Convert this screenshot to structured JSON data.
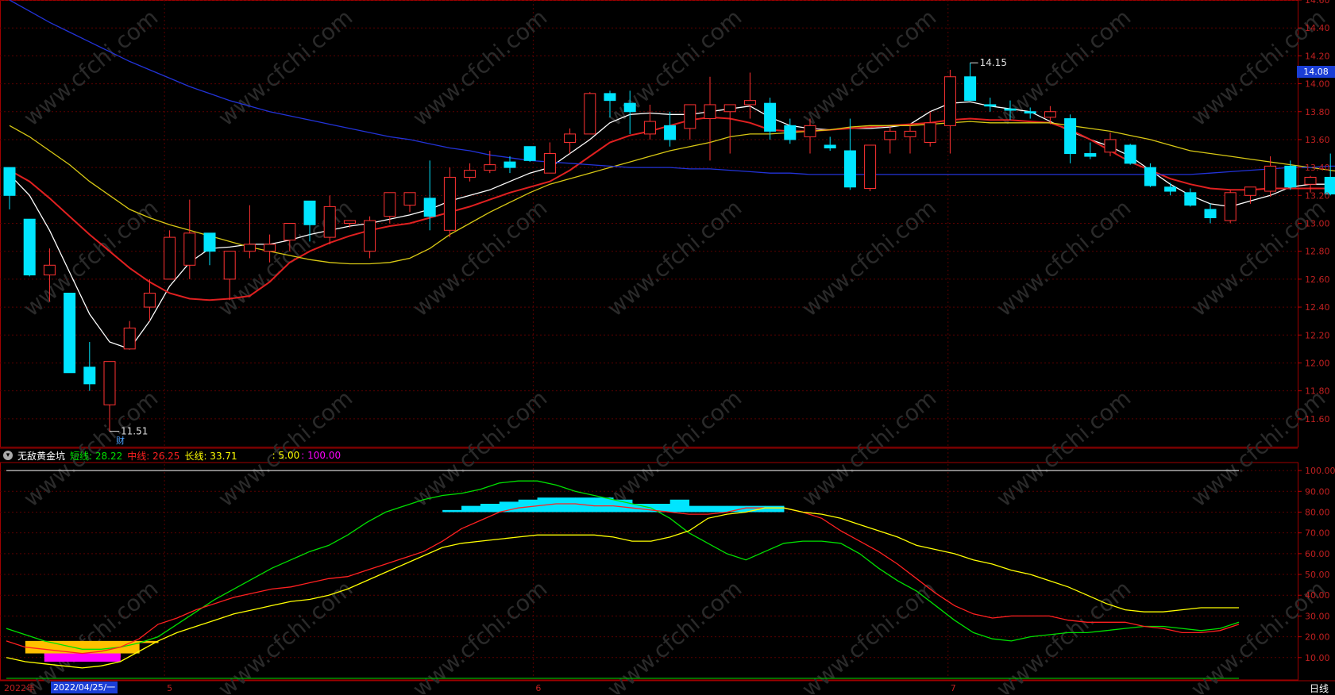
{
  "chart_data": [
    {
      "type": "candlestick",
      "ylim": [
        11.4,
        14.6
      ],
      "y_ticks": [
        "14.60",
        "14.40",
        "14.20",
        "14.00",
        "13.80",
        "13.60",
        "13.40",
        "13.20",
        "13.00",
        "12.80",
        "12.60",
        "12.40",
        "12.20",
        "12.00",
        "11.80",
        "11.60"
      ],
      "current_price": "14.08",
      "annotations": {
        "high_label": "14.15",
        "low_label": "11.51",
        "event_marker": "财"
      },
      "candles": [
        {
          "o": 13.4,
          "h": 13.4,
          "l": 13.1,
          "c": 13.2
        },
        {
          "o": 13.03,
          "h": 13.03,
          "l": 12.62,
          "c": 12.63
        },
        {
          "o": 12.63,
          "h": 12.82,
          "l": 12.44,
          "c": 12.7
        },
        {
          "o": 12.5,
          "h": 12.5,
          "l": 11.93,
          "c": 11.93
        },
        {
          "o": 11.97,
          "h": 12.15,
          "l": 11.8,
          "c": 11.85
        },
        {
          "o": 11.7,
          "h": 12.01,
          "l": 11.51,
          "c": 12.01
        },
        {
          "o": 12.1,
          "h": 12.3,
          "l": 12.1,
          "c": 12.25
        },
        {
          "o": 12.4,
          "h": 12.6,
          "l": 12.3,
          "c": 12.5
        },
        {
          "o": 12.6,
          "h": 12.95,
          "l": 12.6,
          "c": 12.9
        },
        {
          "o": 12.7,
          "h": 13.17,
          "l": 12.6,
          "c": 12.93
        },
        {
          "o": 12.93,
          "h": 12.93,
          "l": 12.7,
          "c": 12.8
        },
        {
          "o": 12.6,
          "h": 12.8,
          "l": 12.45,
          "c": 12.8
        },
        {
          "o": 12.8,
          "h": 13.13,
          "l": 12.75,
          "c": 12.85
        },
        {
          "o": 12.8,
          "h": 12.92,
          "l": 12.72,
          "c": 12.85
        },
        {
          "o": 12.88,
          "h": 13.0,
          "l": 12.8,
          "c": 13.0
        },
        {
          "o": 13.16,
          "h": 13.16,
          "l": 12.87,
          "c": 12.99
        },
        {
          "o": 12.9,
          "h": 13.2,
          "l": 12.85,
          "c": 13.12
        },
        {
          "o": 13.0,
          "h": 13.02,
          "l": 12.97,
          "c": 13.02
        },
        {
          "o": 12.8,
          "h": 13.05,
          "l": 12.75,
          "c": 13.02
        },
        {
          "o": 13.05,
          "h": 13.22,
          "l": 13.0,
          "c": 13.22
        },
        {
          "o": 13.13,
          "h": 13.22,
          "l": 13.08,
          "c": 13.22
        },
        {
          "o": 13.18,
          "h": 13.45,
          "l": 12.95,
          "c": 13.05
        },
        {
          "o": 12.95,
          "h": 13.4,
          "l": 12.9,
          "c": 13.33
        },
        {
          "o": 13.33,
          "h": 13.43,
          "l": 13.3,
          "c": 13.38
        },
        {
          "o": 13.38,
          "h": 13.52,
          "l": 13.36,
          "c": 13.42
        },
        {
          "o": 13.44,
          "h": 13.48,
          "l": 13.36,
          "c": 13.4
        },
        {
          "o": 13.55,
          "h": 13.55,
          "l": 13.44,
          "c": 13.45
        },
        {
          "o": 13.36,
          "h": 13.58,
          "l": 13.36,
          "c": 13.5
        },
        {
          "o": 13.58,
          "h": 13.68,
          "l": 13.5,
          "c": 13.64
        },
        {
          "o": 13.64,
          "h": 13.94,
          "l": 13.64,
          "c": 13.93
        },
        {
          "o": 13.93,
          "h": 13.95,
          "l": 13.76,
          "c": 13.88
        },
        {
          "o": 13.86,
          "h": 13.95,
          "l": 13.64,
          "c": 13.8
        },
        {
          "o": 13.64,
          "h": 13.85,
          "l": 13.6,
          "c": 13.73
        },
        {
          "o": 13.7,
          "h": 13.8,
          "l": 13.55,
          "c": 13.6
        },
        {
          "o": 13.68,
          "h": 13.85,
          "l": 13.6,
          "c": 13.85
        },
        {
          "o": 13.75,
          "h": 14.05,
          "l": 13.45,
          "c": 13.85
        },
        {
          "o": 13.8,
          "h": 13.85,
          "l": 13.5,
          "c": 13.85
        },
        {
          "o": 13.85,
          "h": 14.08,
          "l": 13.75,
          "c": 13.88
        },
        {
          "o": 13.86,
          "h": 13.9,
          "l": 13.6,
          "c": 13.66
        },
        {
          "o": 13.7,
          "h": 13.75,
          "l": 13.57,
          "c": 13.6
        },
        {
          "o": 13.62,
          "h": 13.75,
          "l": 13.5,
          "c": 13.7
        },
        {
          "o": 13.56,
          "h": 13.62,
          "l": 13.52,
          "c": 13.54
        },
        {
          "o": 13.52,
          "h": 13.75,
          "l": 13.24,
          "c": 13.26
        },
        {
          "o": 13.25,
          "h": 13.56,
          "l": 13.23,
          "c": 13.56
        },
        {
          "o": 13.6,
          "h": 13.69,
          "l": 13.5,
          "c": 13.66
        },
        {
          "o": 13.62,
          "h": 13.7,
          "l": 13.5,
          "c": 13.66
        },
        {
          "o": 13.58,
          "h": 13.8,
          "l": 13.55,
          "c": 13.72
        },
        {
          "o": 13.7,
          "h": 14.1,
          "l": 13.5,
          "c": 14.05
        },
        {
          "o": 14.05,
          "h": 14.15,
          "l": 13.88,
          "c": 13.88
        },
        {
          "o": 13.85,
          "h": 13.9,
          "l": 13.8,
          "c": 13.84
        },
        {
          "o": 13.82,
          "h": 13.88,
          "l": 13.74,
          "c": 13.81
        },
        {
          "o": 13.8,
          "h": 13.83,
          "l": 13.75,
          "c": 13.79
        },
        {
          "o": 13.76,
          "h": 13.84,
          "l": 13.71,
          "c": 13.8
        },
        {
          "o": 13.75,
          "h": 13.78,
          "l": 13.43,
          "c": 13.5
        },
        {
          "o": 13.5,
          "h": 13.58,
          "l": 13.46,
          "c": 13.48
        },
        {
          "o": 13.51,
          "h": 13.65,
          "l": 13.48,
          "c": 13.6
        },
        {
          "o": 13.56,
          "h": 13.57,
          "l": 13.42,
          "c": 13.43
        },
        {
          "o": 13.4,
          "h": 13.43,
          "l": 13.26,
          "c": 13.27
        },
        {
          "o": 13.26,
          "h": 13.29,
          "l": 13.2,
          "c": 13.23
        },
        {
          "o": 13.22,
          "h": 13.25,
          "l": 13.12,
          "c": 13.13
        },
        {
          "o": 13.1,
          "h": 13.14,
          "l": 13.0,
          "c": 13.04
        },
        {
          "o": 13.02,
          "h": 13.24,
          "l": 13.0,
          "c": 13.22
        },
        {
          "o": 13.2,
          "h": 13.26,
          "l": 13.14,
          "c": 13.26
        },
        {
          "o": 13.23,
          "h": 13.48,
          "l": 13.19,
          "c": 13.41
        },
        {
          "o": 13.41,
          "h": 13.45,
          "l": 13.24,
          "c": 13.26
        },
        {
          "o": 13.28,
          "h": 13.34,
          "l": 13.22,
          "c": 13.33
        },
        {
          "o": 13.33,
          "h": 13.5,
          "l": 13.2,
          "c": 13.21
        },
        {
          "o": 13.21,
          "h": 13.3,
          "l": 13.15,
          "c": 13.3
        },
        {
          "o": 13.3,
          "h": 13.42,
          "l": 13.28,
          "c": 13.33
        },
        {
          "o": 13.38,
          "h": 13.45,
          "l": 13.31,
          "c": 13.34
        },
        {
          "o": 13.39,
          "h": 13.4,
          "l": 13.18,
          "c": 13.18
        },
        {
          "o": 13.18,
          "h": 13.19,
          "l": 13.14,
          "c": 13.14
        },
        {
          "o": 13.05,
          "h": 13.05,
          "l": 12.3,
          "c": 12.61
        },
        {
          "o": 12.62,
          "h": 12.74,
          "l": 12.6,
          "c": 12.7
        },
        {
          "o": 12.74,
          "h": 12.9,
          "l": 12.64,
          "c": 12.86
        },
        {
          "o": 12.87,
          "h": 12.93,
          "l": 12.84,
          "c": 12.91
        }
      ],
      "ma_lines": [
        {
          "color": "#ffffff",
          "values": [
            13.35,
            13.2,
            12.95,
            12.65,
            12.35,
            12.15,
            12.1,
            12.3,
            12.55,
            12.72,
            12.82,
            12.83,
            12.85,
            12.85,
            12.88,
            12.92,
            12.95,
            12.98,
            13.0,
            13.03,
            13.06,
            13.1,
            13.16,
            13.2,
            13.24,
            13.3,
            13.36,
            13.4,
            13.5,
            13.6,
            13.72,
            13.78,
            13.79,
            13.78,
            13.78,
            13.8,
            13.82,
            13.84,
            13.76,
            13.7,
            13.68,
            13.67,
            13.68,
            13.68,
            13.69,
            13.71,
            13.8,
            13.86,
            13.87,
            13.84,
            13.82,
            13.8,
            13.73,
            13.66,
            13.6,
            13.55,
            13.48,
            13.38,
            13.28,
            13.2,
            13.14,
            13.12,
            13.16,
            13.2,
            13.26,
            13.28,
            13.28,
            13.29,
            13.32,
            13.32,
            13.3,
            13.2,
            13.02,
            12.92,
            12.86,
            12.88
          ]
        },
        {
          "color": "#e02020",
          "values": [
            13.38,
            13.3,
            13.18,
            13.05,
            12.92,
            12.8,
            12.68,
            12.58,
            12.5,
            12.46,
            12.45,
            12.46,
            12.48,
            12.58,
            12.72,
            12.8,
            12.86,
            12.91,
            12.95,
            12.98,
            13.0,
            13.04,
            13.08,
            13.12,
            13.17,
            13.22,
            13.26,
            13.3,
            13.38,
            13.48,
            13.58,
            13.63,
            13.66,
            13.7,
            13.74,
            13.76,
            13.75,
            13.72,
            13.67,
            13.66,
            13.66,
            13.67,
            13.68,
            13.69,
            13.7,
            13.71,
            13.72,
            13.74,
            13.75,
            13.74,
            13.74,
            13.73,
            13.72,
            13.67,
            13.6,
            13.52,
            13.44,
            13.38,
            13.32,
            13.28,
            13.25,
            13.24,
            13.24,
            13.25,
            13.25,
            13.25,
            13.25,
            13.25,
            13.27,
            13.28,
            13.28,
            13.25,
            13.2,
            13.15,
            13.11,
            13.07
          ]
        },
        {
          "color": "#d8c814",
          "values": [
            13.7,
            13.62,
            13.52,
            13.42,
            13.3,
            13.2,
            13.1,
            13.04,
            12.99,
            12.95,
            12.91,
            12.87,
            12.83,
            12.8,
            12.77,
            12.74,
            12.72,
            12.71,
            12.71,
            12.72,
            12.75,
            12.82,
            12.92,
            13.0,
            13.08,
            13.15,
            13.22,
            13.28,
            13.32,
            13.36,
            13.4,
            13.44,
            13.48,
            13.52,
            13.55,
            13.58,
            13.62,
            13.64,
            13.64,
            13.65,
            13.66,
            13.67,
            13.69,
            13.7,
            13.7,
            13.7,
            13.71,
            13.72,
            13.73,
            13.72,
            13.72,
            13.72,
            13.72,
            13.7,
            13.68,
            13.66,
            13.63,
            13.6,
            13.56,
            13.52,
            13.5,
            13.48,
            13.46,
            13.44,
            13.42,
            13.4,
            13.38,
            13.36,
            13.34,
            13.32,
            13.3,
            13.28,
            13.25,
            13.22,
            13.2,
            13.16
          ]
        },
        {
          "color": "#2233d8",
          "values": [
            14.6,
            14.52,
            14.44,
            14.37,
            14.3,
            14.23,
            14.16,
            14.1,
            14.04,
            13.98,
            13.93,
            13.88,
            13.84,
            13.8,
            13.77,
            13.74,
            13.71,
            13.68,
            13.65,
            13.62,
            13.6,
            13.57,
            13.54,
            13.52,
            13.49,
            13.47,
            13.45,
            13.44,
            13.43,
            13.42,
            13.41,
            13.4,
            13.4,
            13.4,
            13.39,
            13.39,
            13.38,
            13.37,
            13.36,
            13.36,
            13.35,
            13.35,
            13.35,
            13.35,
            13.35,
            13.35,
            13.35,
            13.35,
            13.35,
            13.35,
            13.35,
            13.35,
            13.35,
            13.35,
            13.35,
            13.35,
            13.35,
            13.35,
            13.35,
            13.35,
            13.36,
            13.37,
            13.38,
            13.39,
            13.4,
            13.4,
            13.41,
            13.41,
            13.41,
            13.41,
            13.41
          ]
        }
      ]
    },
    {
      "type": "line",
      "title": "无敌黄金坑",
      "legend": [
        {
          "label": "短线: 28.22",
          "color": "#00e000"
        },
        {
          "label": "中线: 26.25",
          "color": "#ff2020"
        },
        {
          "label": "长线: 33.71",
          "color": "#ffff00"
        },
        {
          "label": ": 5.00",
          "color": "#ffff00"
        },
        {
          "label": ": 100.00",
          "color": "#ff00ff"
        }
      ],
      "ylim": [
        0,
        105
      ],
      "y_ticks": [
        "100.00",
        "90.00",
        "80.00",
        "70.00",
        "60.00",
        "50.00",
        "40.00",
        "30.00",
        "20.00",
        "10.00"
      ],
      "x_labels": [
        {
          "label": "2022年",
          "index": 0
        },
        {
          "label": "5",
          "index": 7
        },
        {
          "label": "6",
          "index": 23
        },
        {
          "label": "7",
          "index": 41
        },
        {
          "label": "8",
          "index": 59
        }
      ],
      "date_badge": "2022/04/25/一",
      "period": "日线",
      "ref_lines": [
        {
          "value": 100,
          "color": "#cccccc"
        },
        {
          "value": 0,
          "color": "#00b000"
        }
      ],
      "series": [
        {
          "name": "短线",
          "color": "#00e000",
          "values": [
            24,
            21,
            18,
            16,
            14,
            14,
            15,
            17,
            20,
            26,
            32,
            38,
            43,
            48,
            53,
            57,
            61,
            64,
            69,
            75,
            80,
            83,
            86,
            88,
            89,
            91,
            94,
            95,
            95,
            93,
            90,
            88,
            86,
            84,
            82,
            77,
            70,
            65,
            60,
            57,
            61,
            65,
            66,
            66,
            65,
            60,
            53,
            47,
            42,
            35,
            28,
            22,
            19,
            18,
            20,
            21,
            22,
            22,
            23,
            24,
            25,
            25,
            24,
            23,
            24,
            27
          ]
        },
        {
          "name": "中线",
          "color": "#ff2020",
          "values": [
            18,
            15,
            14,
            13,
            12,
            13,
            15,
            19,
            26,
            29,
            33,
            36,
            39,
            41,
            43,
            44,
            46,
            48,
            49,
            52,
            55,
            58,
            61,
            66,
            72,
            76,
            80,
            82,
            83,
            84,
            84,
            83,
            83,
            82,
            81,
            80,
            79,
            79,
            80,
            82,
            82,
            82,
            80,
            77,
            71,
            66,
            61,
            55,
            48,
            41,
            35,
            31,
            29,
            30,
            30,
            30,
            28,
            27,
            27,
            27,
            25,
            24,
            22,
            22,
            23,
            26
          ]
        },
        {
          "name": "长线",
          "color": "#ffff00",
          "values": [
            10,
            8,
            7,
            6,
            5,
            6,
            8,
            13,
            18,
            22,
            25,
            28,
            31,
            33,
            35,
            37,
            38,
            40,
            43,
            47,
            51,
            55,
            59,
            63,
            65,
            66,
            67,
            68,
            69,
            69,
            69,
            69,
            68,
            66,
            66,
            68,
            71,
            77,
            79,
            80,
            82,
            82,
            80,
            79,
            77,
            74,
            71,
            68,
            64,
            62,
            60,
            57,
            55,
            52,
            50,
            47,
            44,
            40,
            36,
            33,
            32,
            32,
            33,
            34,
            34,
            34
          ]
        }
      ],
      "signal_blocks": {
        "cyan_from": 23,
        "cyan_to": 36,
        "cyan2_from": 36,
        "cyan2_to": 41
      }
    }
  ]
}
